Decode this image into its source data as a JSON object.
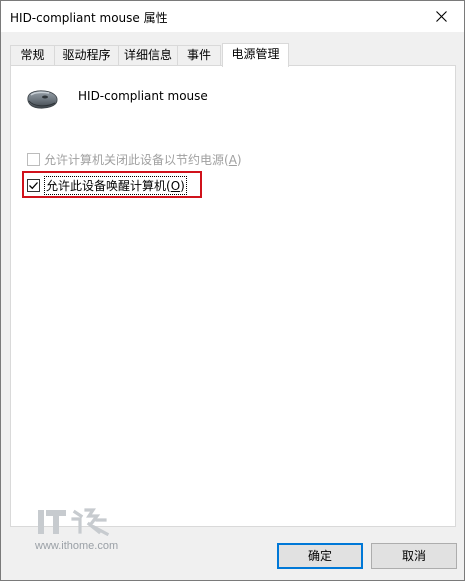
{
  "window": {
    "title": "HID-compliant mouse 属性"
  },
  "tabs": [
    {
      "label": "常规"
    },
    {
      "label": "驱动程序"
    },
    {
      "label": "详细信息"
    },
    {
      "label": "事件"
    },
    {
      "label": "电源管理",
      "active": true
    }
  ],
  "device": {
    "name": "HID-compliant mouse",
    "icon": "mouse-icon"
  },
  "options": [
    {
      "label": "允许计算机关闭此设备以节约电源",
      "mnemonic": "A",
      "checked": false,
      "enabled": false
    },
    {
      "label": "允许此设备唤醒计算机",
      "mnemonic": "O",
      "checked": true,
      "enabled": true
    }
  ],
  "watermark": {
    "logo_text": "IT",
    "logo_char": "之家",
    "url": "www.ithome.com"
  },
  "buttons": {
    "ok_label": "确定",
    "cancel_label": "取消"
  },
  "colors": {
    "highlight": "#d0121b",
    "default_button_border": "#0078d7"
  }
}
